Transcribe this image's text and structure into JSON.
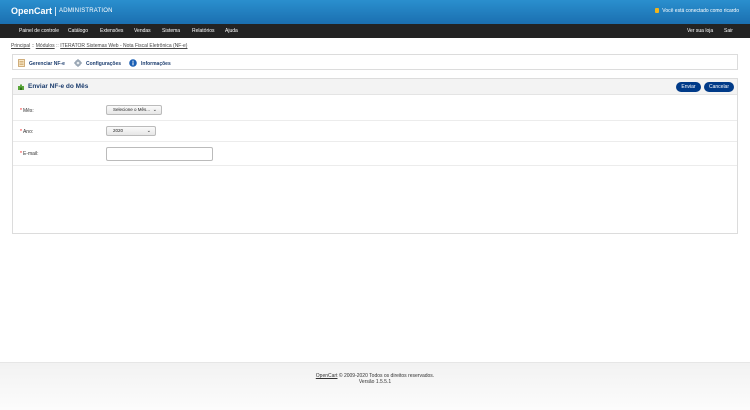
{
  "header": {
    "logo": "OpenCart",
    "subtitle": "ADMINISTRATION",
    "logged_text": "Você está conectado como ricardo"
  },
  "menu": {
    "items": [
      "Painel de controle",
      "Catálogo",
      "Extensões",
      "Vendas",
      "Sistema",
      "Relatórios",
      "Ajuda"
    ],
    "right": [
      "Ver sua loja",
      "Sair"
    ]
  },
  "breadcrumb": {
    "items": [
      "Principal",
      "Módulos",
      "ITERATOR Sistemas Web - Nota Fiscal Eletrônica (NF-e)"
    ],
    "separator": "::"
  },
  "tabs": {
    "items": [
      "Gerenciar NF-e",
      "Configurações",
      "Informações"
    ]
  },
  "panel": {
    "title": "Enviar NF-e do Mês",
    "send_label": "Enviar",
    "cancel_label": "Cancelar"
  },
  "form": {
    "month": {
      "label": "Mês:",
      "value": "Selecione o Mês..."
    },
    "year": {
      "label": "Ano:",
      "value": "2020"
    },
    "email": {
      "label": "E-mail:",
      "value": ""
    }
  },
  "footer": {
    "link": "OpenCart",
    "copyright": " © 2009-2020 Todos os direitos reservados.",
    "version": "Versão 1.5.5.1"
  },
  "colors": {
    "header": "#1b6fb0",
    "menu": "#232323",
    "button": "#003a88",
    "title": "#1c3d6e",
    "required": "#ee0000"
  }
}
